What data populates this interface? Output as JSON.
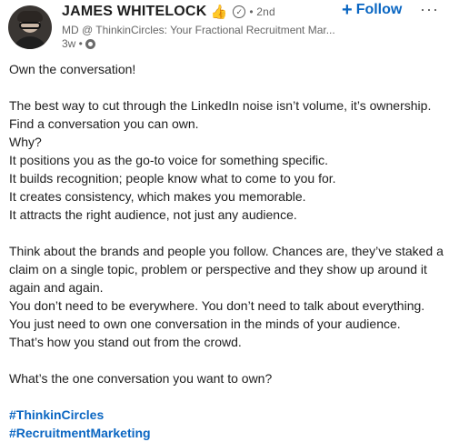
{
  "author": {
    "name": "JAMES WHITELOCK",
    "degree": "• 2nd",
    "headline": "MD @ ThinkinCircles: Your Fractional Recruitment Mar...",
    "time": "3w •"
  },
  "follow_label": "Follow",
  "icons": {
    "plus": "plus-icon",
    "more": "more-icon",
    "hand": "thumbs-up-hand-icon",
    "verified": "verified-icon",
    "globe": "globe-icon"
  },
  "post": {
    "lines": [
      "Own the conversation!",
      "",
      "The best way to cut through the LinkedIn noise isn’t volume, it’s ownership.",
      "Find a conversation you can own.",
      "Why?",
      "It positions you as the go-to voice for something specific.",
      "It builds recognition; people know what to come to you for.",
      "It creates consistency, which makes you memorable.",
      "It attracts the right audience, not just any audience.",
      "",
      "Think about the brands and people you follow. Chances are, they’ve staked a",
      "claim on a single topic, problem or perspective and they show up around it",
      "again and again.",
      "You don’t need to be everywhere. You don’t need to talk about everything.",
      "You just need to own one conversation in the minds of your audience.",
      "That’s how you stand out from the crowd.",
      "",
      "What’s the one conversation you want to own?",
      ""
    ],
    "hashtags": [
      "#ThinkinCircles",
      "#RecruitmentMarketing"
    ]
  },
  "colors": {
    "accent": "#0a66c2",
    "text": "#1d1d1d",
    "muted": "#666666"
  }
}
